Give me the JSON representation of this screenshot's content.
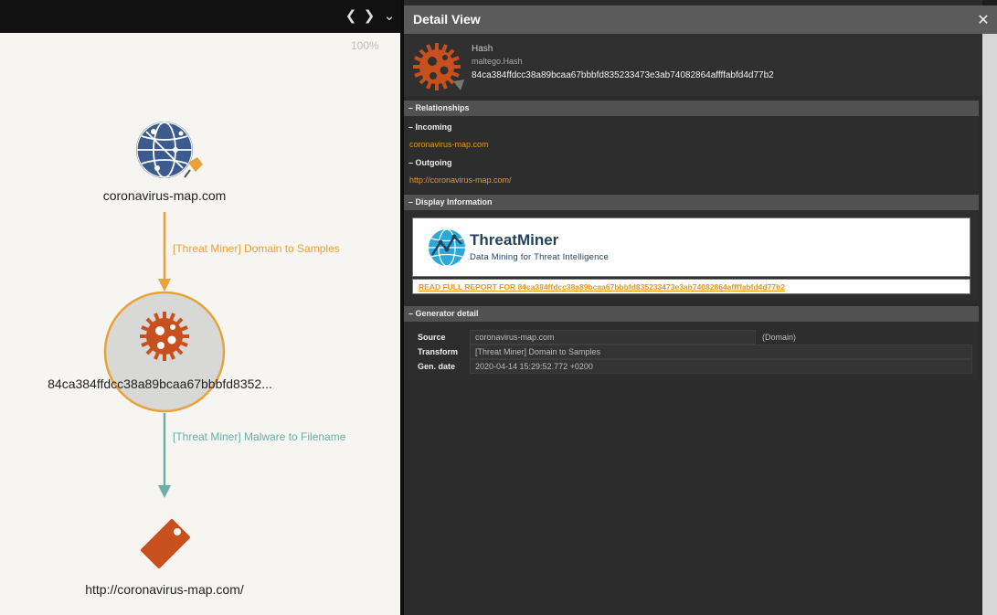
{
  "graph": {
    "zoom": "100%",
    "nodes": [
      {
        "label": "coronavirus-map.com",
        "icon": "globe-icon"
      },
      {
        "label": "84ca384ffdcc38a89bcaa67bbbfd8352...",
        "icon": "malware-icon"
      },
      {
        "label": "http://coronavirus-map.com/",
        "icon": "tag-icon"
      }
    ],
    "edges": [
      {
        "label": "[Threat Miner] Domain to Samples",
        "color": "#e8a23a"
      },
      {
        "label": "[Threat Miner] Malware to Filename",
        "color": "#6aaea6"
      }
    ]
  },
  "detail": {
    "title": "Detail View",
    "close_icon": "close-icon",
    "entity": {
      "type": "Hash",
      "namespace": "maltego.Hash",
      "value": "84ca384ffdcc38a89bcaa67bbbfd835233473e3ab74082864affffabfd4d77b2",
      "icon": "malware-icon"
    },
    "relationships": {
      "header": "– Relationships",
      "incoming_header": "– Incoming",
      "incoming": [
        "coronavirus-map.com"
      ],
      "outgoing_header": "– Outgoing",
      "outgoing": [
        "http://coronavirus-map.com/"
      ]
    },
    "display_info": {
      "header": "– Display Information",
      "brand_name": "ThreatMiner",
      "brand_tagline": "Data Mining for Threat Intelligence",
      "report_link": "READ FULL REPORT FOR 84ca384ffdcc38a89bcaa67bbbfd835233473e3ab74082864affffabfd4d77b2"
    },
    "generator": {
      "header": "– Generator detail",
      "rows": [
        {
          "key": "Source",
          "value": "coronavirus-map.com",
          "extra": "(Domain)"
        },
        {
          "key": "Transform",
          "value": "[Threat Miner] Domain  to Samples"
        },
        {
          "key": "Gen. date",
          "value": "2020-04-14 15:29:52.772 +0200"
        }
      ]
    }
  },
  "colors": {
    "accent": "#e8961e",
    "edge_orange": "#e8a23a",
    "edge_teal": "#6aaea6",
    "malware": "#c8501e",
    "globe": "#3b5b8f",
    "panel_bg": "#2b2b2b"
  }
}
